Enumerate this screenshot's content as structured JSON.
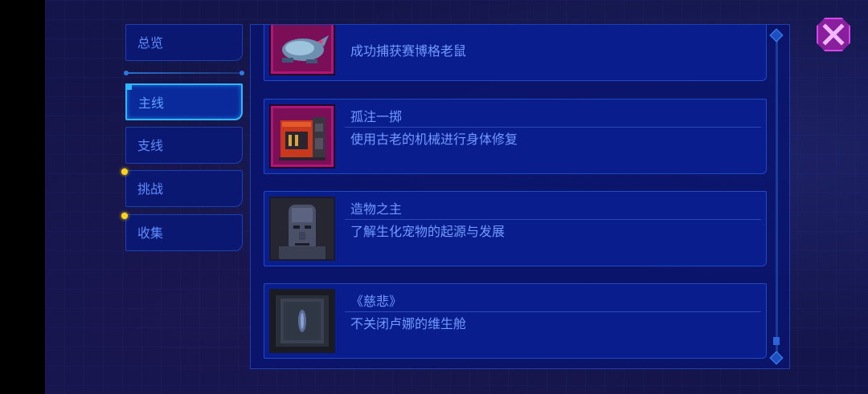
{
  "sidebar": {
    "items": [
      {
        "label": "总览",
        "active": false,
        "has_dot": false
      },
      {
        "label": "主线",
        "active": true,
        "has_dot": false
      },
      {
        "label": "支线",
        "active": false,
        "has_dot": false
      },
      {
        "label": "挑战",
        "active": false,
        "has_dot": true
      },
      {
        "label": "收集",
        "active": false,
        "has_dot": true
      }
    ]
  },
  "achievements": [
    {
      "title": "",
      "desc": "成功捕获赛博格老鼠",
      "icon": "cyborg-rat-icon"
    },
    {
      "title": "孤注一掷",
      "desc": "使用古老的机械进行身体修复",
      "icon": "repair-machine-icon"
    },
    {
      "title": "造物之主",
      "desc": "了解生化宠物的起源与发展",
      "icon": "android-face-icon"
    },
    {
      "title": "《慈悲》",
      "desc": "不关闭卢娜的维生舱",
      "icon": "life-pod-icon"
    }
  ],
  "colors": {
    "accent": "#2fb6ff",
    "text": "#6f9bff",
    "notify_dot": "#ffd21a",
    "close": "#8a1f9e"
  }
}
